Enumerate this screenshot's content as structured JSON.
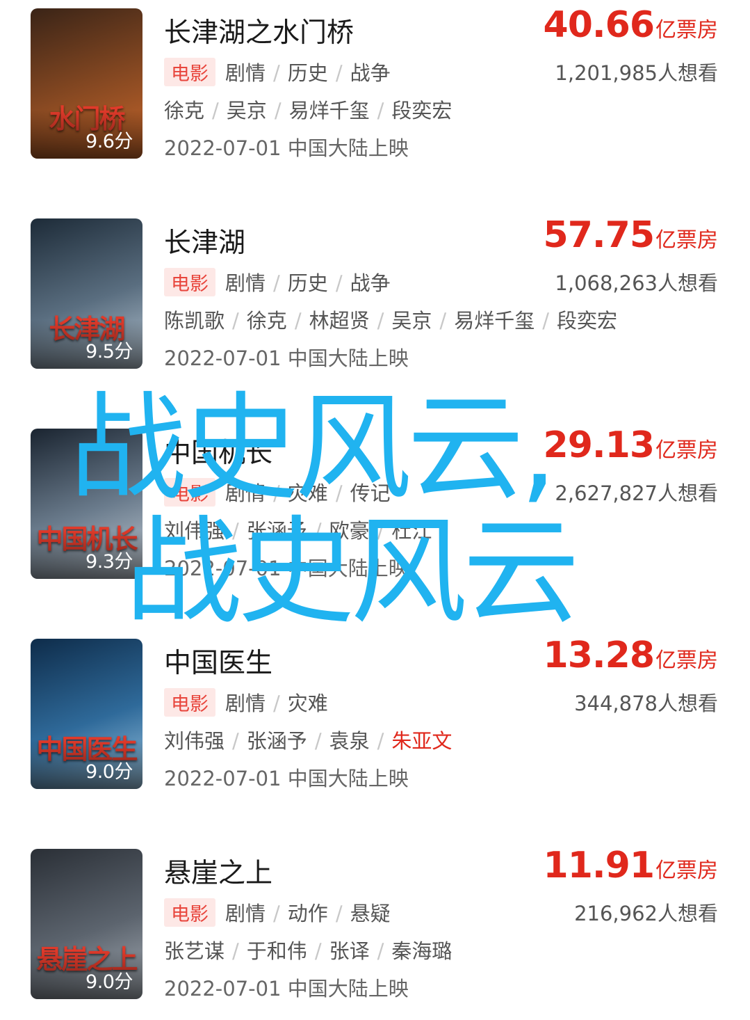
{
  "movies": [
    {
      "title": "长津湖之水门桥",
      "score": "9.6分",
      "tag": "电影",
      "genres": [
        "剧情",
        "历史",
        "战争"
      ],
      "cast": [
        "徐克",
        "吴京",
        "易烊千玺",
        "段奕宏"
      ],
      "release": "2022-07-01 中国大陆上映",
      "box_office": "40.66",
      "box_unit": "亿票房",
      "want": "1,201,985人想看",
      "poster_text": "水门桥",
      "poster_colors": [
        "#3a2417",
        "#8a4a22",
        "#c9672b"
      ]
    },
    {
      "title": "长津湖",
      "score": "9.5分",
      "tag": "电影",
      "genres": [
        "剧情",
        "历史",
        "战争"
      ],
      "cast": [
        "陈凯歌",
        "徐克",
        "林超贤",
        "吴京",
        "易烊千玺",
        "段奕宏"
      ],
      "release": "2022-07-01 中国大陆上映",
      "box_office": "57.75",
      "box_unit": "亿票房",
      "want": "1,068,263人想看",
      "poster_text": "长津湖",
      "poster_colors": [
        "#1d2b38",
        "#5a6e80",
        "#b7c6d3"
      ]
    },
    {
      "title": "中国机长",
      "score": "9.3分",
      "tag": "电影",
      "genres": [
        "剧情",
        "灾难",
        "传记"
      ],
      "cast": [
        "刘伟强",
        "张涵予",
        "欧豪",
        "杜江"
      ],
      "release": "2022-07-01 中国大陆上映",
      "box_office": "29.13",
      "box_unit": "亿票房",
      "want": "2,627,827人想看",
      "poster_text": "中国机长",
      "poster_colors": [
        "#1a2430",
        "#6b7c8d",
        "#c6cfd8"
      ]
    },
    {
      "title": "中国医生",
      "score": "9.0分",
      "tag": "电影",
      "genres": [
        "剧情",
        "灾难"
      ],
      "cast": [
        "刘伟强",
        "张涵予",
        "袁泉",
        "朱亚文"
      ],
      "highlight_index": 3,
      "release": "2022-07-01 中国大陆上映",
      "box_office": "13.28",
      "box_unit": "亿票房",
      "want": "344,878人想看",
      "poster_text": "中国医生",
      "poster_colors": [
        "#0e2c4a",
        "#2f6a9a",
        "#9cc6e2"
      ]
    },
    {
      "title": "悬崖之上",
      "score": "9.0分",
      "tag": "电影",
      "genres": [
        "剧情",
        "动作",
        "悬疑"
      ],
      "cast": [
        "张艺谋",
        "于和伟",
        "张译",
        "秦海璐"
      ],
      "release": "2022-07-01 中国大陆上映",
      "box_office": "11.91",
      "box_unit": "亿票房",
      "want": "216,962人想看",
      "poster_text": "悬崖之上",
      "poster_colors": [
        "#2a2f36",
        "#5c646e",
        "#a9b0b8"
      ]
    }
  ],
  "overlay_text": "战史风云,战史风云"
}
